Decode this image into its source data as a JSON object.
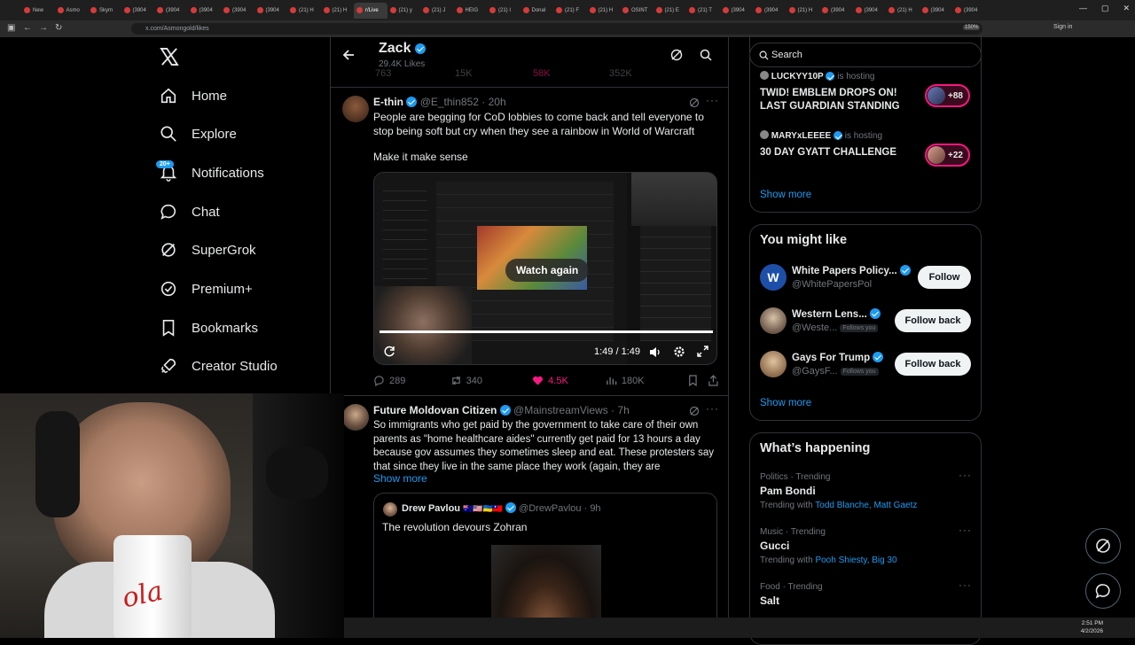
{
  "browser": {
    "tabs": [
      "New",
      "Asmo",
      "Skym",
      "(3904",
      "(3904",
      "(3904",
      "(3904",
      "(3904",
      "(21) H",
      "(21) H",
      "r/Live",
      "(21) y",
      "(21) J",
      "HEIG",
      "(21) I",
      "Donal",
      "(21) F",
      "(21) H",
      "OSINT",
      "(21) E",
      "(21) T",
      "(3904",
      "(3904",
      "(21) H",
      "(3904",
      "(3904",
      "(21) H",
      "(3904",
      "(3904"
    ],
    "url": "x.com/Asmongold/likes",
    "zoom": "150%",
    "signin": "Sign in"
  },
  "nav": {
    "items": [
      {
        "label": "Home",
        "icon": "home-icon"
      },
      {
        "label": "Explore",
        "icon": "search-icon"
      },
      {
        "label": "Notifications",
        "icon": "bell-icon"
      },
      {
        "label": "Chat",
        "icon": "chat-icon"
      },
      {
        "label": "SuperGrok",
        "icon": "grok-icon"
      },
      {
        "label": "Premium+",
        "icon": "verified-icon"
      },
      {
        "label": "Bookmarks",
        "icon": "bookmark-icon"
      },
      {
        "label": "Creator Studio",
        "icon": "rocket-icon"
      }
    ],
    "notif_badge": "20+"
  },
  "header": {
    "name": "Zack",
    "likes": "29.4K Likes"
  },
  "prev_post": {
    "replies": "763",
    "reposts": "15K",
    "likes": "58K",
    "views": "352K"
  },
  "post1": {
    "name": "E-thin",
    "handle": "@E_thin852",
    "time": "20h",
    "text1": "People are begging for CoD lobbies to come back and tell everyone to stop being soft but cry when they see a rainbow in World of Warcraft",
    "text2": "Make it make sense",
    "video_overlay": "Watch again",
    "video_time": "1:49 / 1:49",
    "replies": "289",
    "reposts": "340",
    "likes": "4.5K",
    "views": "180K"
  },
  "post2": {
    "name": "Future Moldovan Citizen",
    "handle": "@MainstreamViews",
    "time": "7h",
    "text": "So immigrants who get paid by the government to take care of their own parents as \"home healthcare aides\" currently get paid for 13 hours a day because gov assumes they sometimes sleep and eat. These protesters say that since they live in the same place they work (again, they are",
    "show_more": "Show more",
    "quote": {
      "name": "Drew Pavlou",
      "flags": "🇦🇺🇺🇸🇺🇦🇹🇼",
      "handle": "@DrewPavlou",
      "time": "9h",
      "text": "The revolution devours Zohran"
    }
  },
  "search": {
    "placeholder": "Search"
  },
  "spaces": {
    "items": [
      {
        "host": "LUCKYY10P",
        "status": "is hosting",
        "title": "TWID! EMBLEM DROPS ON! LAST GUARDIAN STANDING",
        "count": "+88"
      },
      {
        "host": "MARYxLEEEE",
        "status": "is hosting",
        "title": "30 DAY GYATT CHALLENGE",
        "count": "+22"
      }
    ],
    "show_more": "Show more"
  },
  "might_like": {
    "title": "You might like",
    "items": [
      {
        "name": "White Papers Policy...",
        "handle": "@WhitePapersPol",
        "button": "Follow",
        "follows_you": ""
      },
      {
        "name": "Western Lens...",
        "handle": "@Weste...",
        "button": "Follow back",
        "follows_you": "Follows you"
      },
      {
        "name": "Gays For Trump",
        "handle": "@GaysF...",
        "button": "Follow back",
        "follows_you": "Follows you"
      }
    ],
    "show_more": "Show more"
  },
  "happening": {
    "title": "What’s happening",
    "items": [
      {
        "meta": "Politics · Trending",
        "name": "Pam Bondi",
        "with_label": "Trending with",
        "with": "Todd Blanche, Matt Gaetz"
      },
      {
        "meta": "Music · Trending",
        "name": "Gucci",
        "with_label": "Trending with",
        "with": "Pooh Shiesty, Big 30"
      },
      {
        "meta": "Food · Trending",
        "name": "Salt",
        "with_label": "",
        "with": ""
      }
    ]
  },
  "taskbar": {
    "time": "2:51 PM",
    "date": "4/2/2026"
  },
  "colors": {
    "accent": "#1d9bf0",
    "like": "#f91880",
    "bg": "#000000",
    "border": "#2f3336"
  }
}
